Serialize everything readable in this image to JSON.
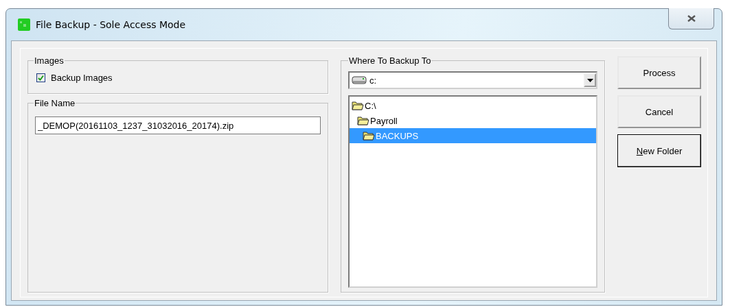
{
  "window": {
    "title": "File Backup - Sole Access Mode"
  },
  "images_group": {
    "label": "Images",
    "checkbox": {
      "label": "Backup Images",
      "checked": true
    }
  },
  "file_name_group": {
    "label": "File Name",
    "value": "_DEMOP(20161103_1237_31032016_20174).zip"
  },
  "destination_group": {
    "label": "Where To Backup To",
    "drive": {
      "value": "c:"
    },
    "folders": [
      {
        "label": "C:\\",
        "selected": false,
        "children": [
          {
            "label": "Payroll",
            "selected": false,
            "children": [
              {
                "label": "BACKUPS",
                "selected": true
              }
            ]
          }
        ]
      }
    ]
  },
  "buttons": [
    {
      "label": "Process",
      "default": false,
      "mnemonic": false
    },
    {
      "label": "Cancel",
      "default": false,
      "mnemonic": false
    },
    {
      "label": "New Folder",
      "default": true,
      "mnemonic": true
    }
  ]
}
